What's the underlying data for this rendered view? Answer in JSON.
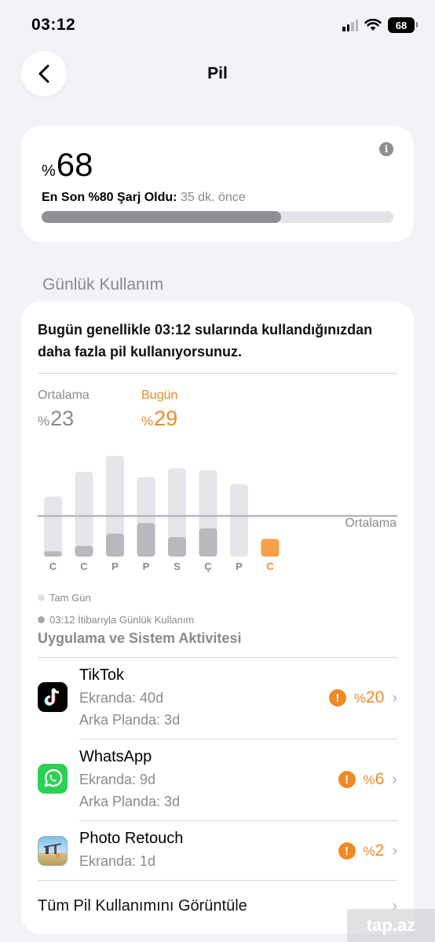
{
  "status_bar": {
    "time": "03:12",
    "battery_level": "68"
  },
  "nav": {
    "title": "Pil"
  },
  "battery_card": {
    "percent_sign": "%",
    "level": "68",
    "last_charge_label": "En Son %80 Şarj Oldu:",
    "last_charge_ago": "35 dk. önce",
    "progress_fraction": 0.68
  },
  "section_header": "Günlük Kullanım",
  "usage_card": {
    "message": "Bugün genellikle 03:12 sularında kullandığınızdan daha fazla pil kullanıyorsunuz.",
    "average": {
      "label": "Ortalama",
      "percent_sign": "%",
      "value": "23"
    },
    "today": {
      "label": "Bugün",
      "percent_sign": "%",
      "value": "29"
    },
    "legend_full_day": "Tam Gün",
    "legend_usage": "03:12 İtibarıyla Günlük Kullanım",
    "app_section_title": "Uygulama ve Sistem Aktivitesi",
    "view_all": "Tüm Pil Kullanımını Görüntüle"
  },
  "chart_data": {
    "type": "bar",
    "categories": [
      "C",
      "C",
      "P",
      "P",
      "S",
      "Ç",
      "P",
      "C"
    ],
    "series": [
      {
        "name": "Tam Gün",
        "values": [
          34,
          48,
          57,
          45,
          50,
          49,
          41,
          0
        ]
      },
      {
        "name": "03:12 İtibarıyla Günlük Kullanım",
        "values": [
          3,
          6,
          13,
          19,
          11,
          16,
          0,
          10
        ]
      }
    ],
    "average_line_label": "Ortalama",
    "average_line_value": 23,
    "today_index": 7,
    "colors": {
      "full_day": "#e5e5ea",
      "usage": "#b8b8bd",
      "today": "#f5a04a",
      "average_line": "#b8b8bd"
    }
  },
  "apps": [
    {
      "name": "TikTok",
      "screen": "Ekranda: 40d",
      "background": "Arka Planda: 3d",
      "percent_sign": "%",
      "percent": "20",
      "icon": "tiktok-app-icon"
    },
    {
      "name": "WhatsApp",
      "screen": "Ekranda: 9d",
      "background": "Arka Planda: 3d",
      "percent_sign": "%",
      "percent": "6",
      "icon": "whatsapp-app-icon"
    },
    {
      "name": "Photo Retouch",
      "screen": "Ekranda: 1d",
      "percent_sign": "%",
      "percent": "2",
      "icon": "photo-retouch-app-icon"
    }
  ],
  "watermark": "tap.az",
  "colors": {
    "accent_orange": "#f08a24",
    "background": "#f2f2f7",
    "card": "#ffffff"
  }
}
